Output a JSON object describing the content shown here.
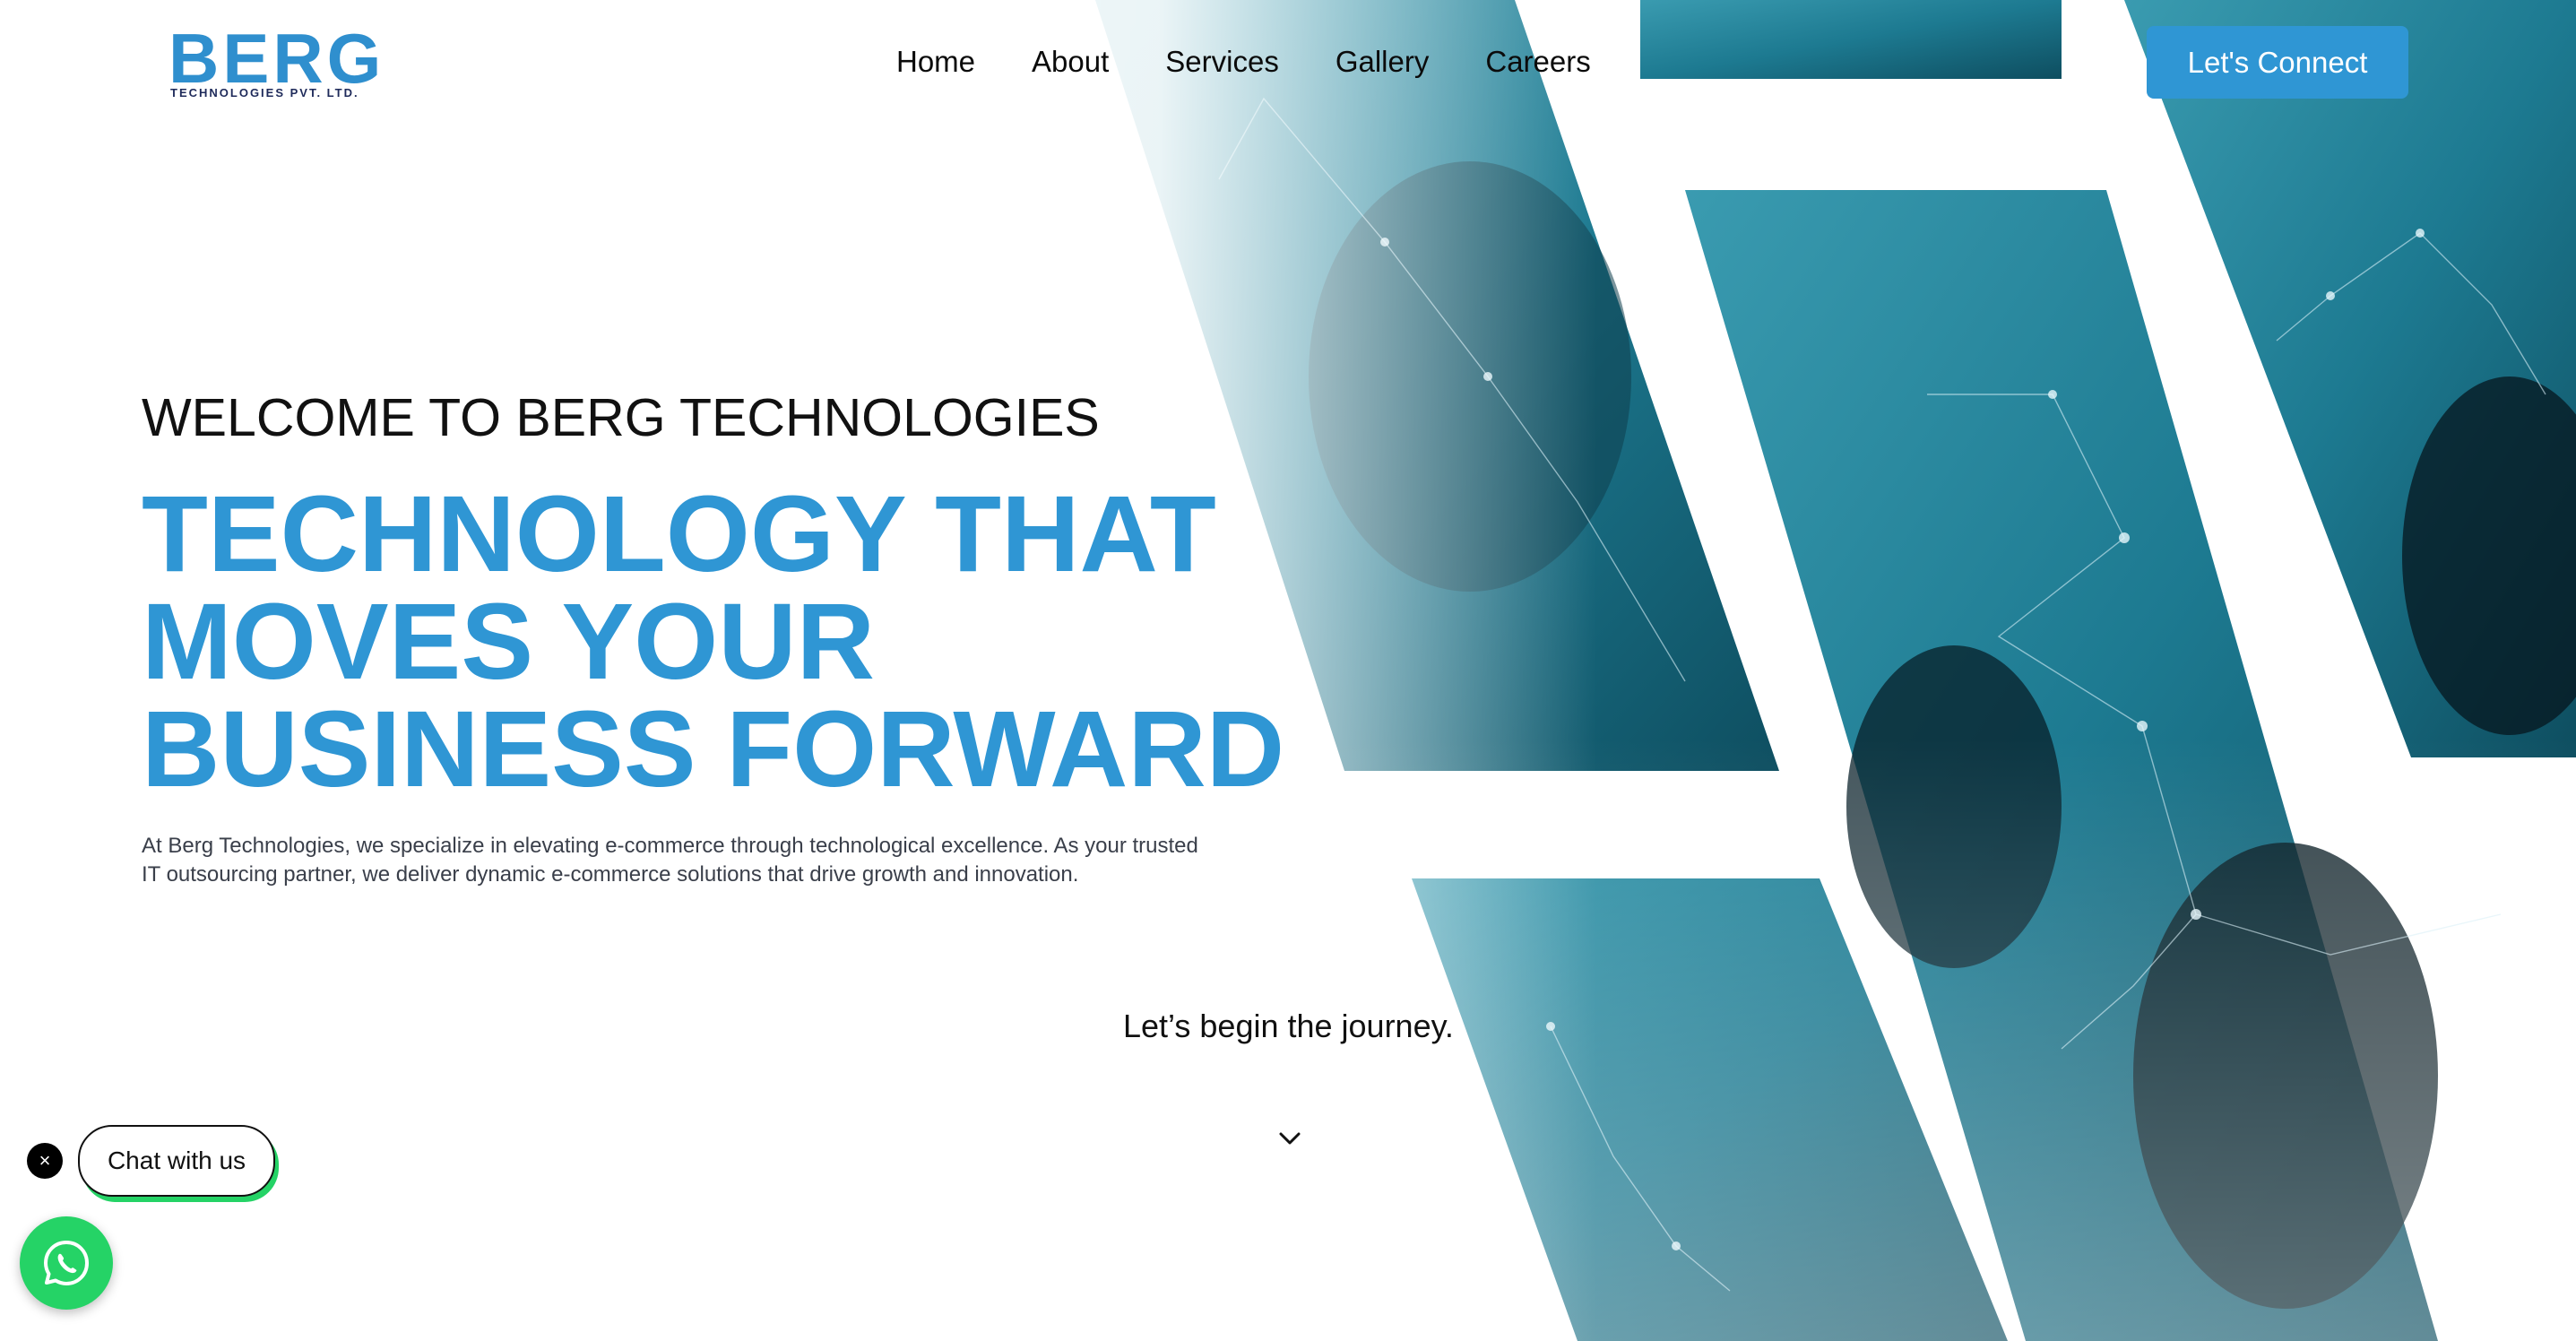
{
  "brand": {
    "name": "BERG",
    "tagline": "TECHNOLOGIES PVT. LTD.",
    "primary_color": "#2f96d4",
    "dark_color": "#1e2a5a"
  },
  "nav": {
    "items": [
      {
        "label": "Home"
      },
      {
        "label": "About"
      },
      {
        "label": "Services"
      },
      {
        "label": "Gallery"
      },
      {
        "label": "Careers"
      }
    ],
    "cta_label": "Let's Connect"
  },
  "hero": {
    "welcome": "WELCOME TO BERG TECHNOLOGIES",
    "headline_lines": [
      "TECHNOLOGY THAT",
      "MOVES YOUR",
      "BUSINESS FORWARD"
    ],
    "description": "At Berg Technologies, we specialize in elevating e-commerce through technological excellence. As your trusted IT outsourcing partner, we deliver dynamic e-commerce solutions that drive growth and innovation.",
    "journey": "Let’s begin the journey.",
    "scroll_icon": "chevron-down-icon"
  },
  "chat": {
    "label": "Chat with us",
    "close_icon": "close-icon",
    "whatsapp_icon": "whatsapp-icon",
    "whatsapp_color": "#25d366"
  },
  "colors": {
    "teal": "#1f7f97",
    "accent_blue": "#2f96d4"
  }
}
